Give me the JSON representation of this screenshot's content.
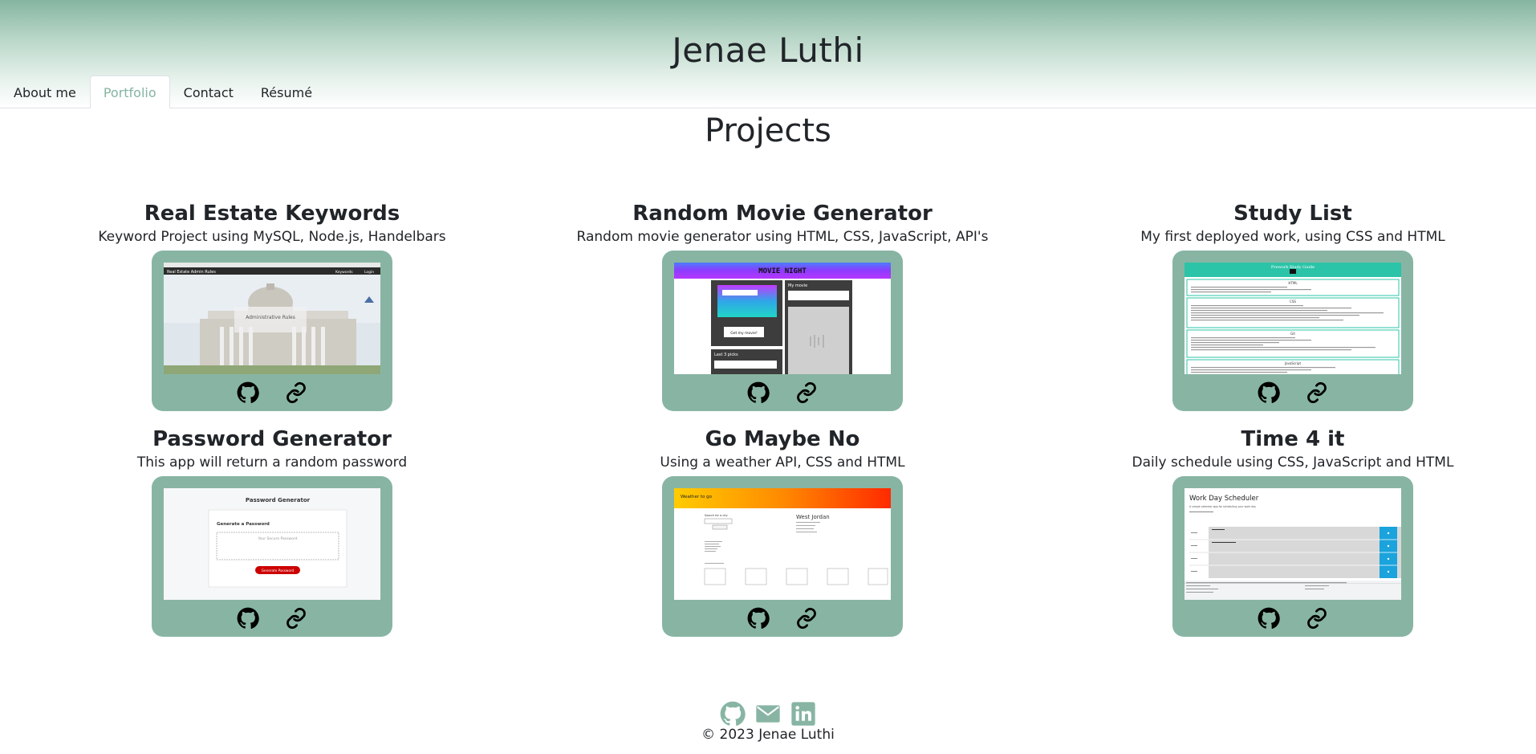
{
  "site": {
    "title": "Jenae Luthi"
  },
  "nav": {
    "items": [
      {
        "label": "About me",
        "active": false
      },
      {
        "label": "Portfolio",
        "active": true
      },
      {
        "label": "Contact",
        "active": false
      },
      {
        "label": "Résumé",
        "active": false
      }
    ]
  },
  "main": {
    "section_title": "Projects"
  },
  "projects": [
    {
      "title": "Real Estate Keywords",
      "description": "Keyword Project using MySQL, Node.js, Handelbars",
      "thumb_text": [
        "Real Estate Admin Rules",
        "Keywords",
        "Login",
        "Administrative Rules"
      ]
    },
    {
      "title": "Random Movie Generator",
      "description": "Random movie generator using HTML, CSS, JavaScript, API's",
      "thumb_text": [
        "MOVIE NIGHT",
        "My movie",
        "Last 3 picks",
        "Get my movie!"
      ]
    },
    {
      "title": "Study List",
      "description": "My first deployed work, using CSS and HTML",
      "thumb_text": [
        "Prework Study Guide",
        "HTML",
        "CSS",
        "Git",
        "JavaScript"
      ]
    },
    {
      "title": "Password Generator",
      "description": "This app will return a random password",
      "thumb_text": [
        "Password Generator",
        "Generate a Password",
        "Your Secure Password",
        "Generate Password"
      ]
    },
    {
      "title": "Go Maybe No",
      "description": "Using a weather API, CSS and HTML",
      "thumb_text": [
        "Weather to go",
        "West Jordan",
        "Search for a city"
      ]
    },
    {
      "title": "Time 4 it",
      "description": "Daily schedule using CSS, JavaScript and HTML",
      "thumb_text": [
        "Work Day Scheduler",
        "A simple calendar app for scheduling your work day"
      ]
    }
  ],
  "footer": {
    "copyright": "© 2023 Jenae Luthi"
  },
  "colors": {
    "accent": "#88b5a3",
    "header_top": "#85b5a0"
  }
}
